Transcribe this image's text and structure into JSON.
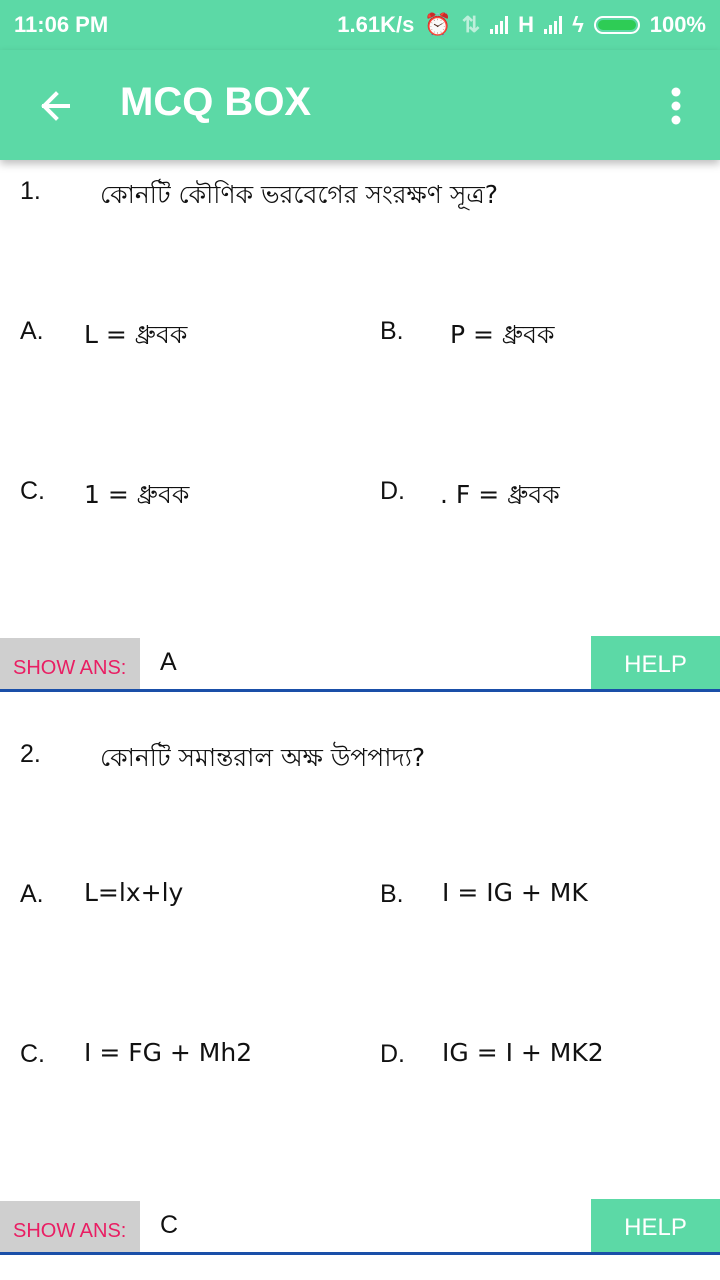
{
  "status_bar": {
    "time": "11:06 PM",
    "speed": "1.61K/s",
    "network": "H",
    "battery": "100%"
  },
  "app_bar": {
    "title": "MCQ BOX",
    "back_icon": "arrow-left-icon",
    "menu_icon": "more-vert-icon"
  },
  "colors": {
    "primary": "#5cd9a6",
    "show_ans_text": "#e91e63",
    "show_ans_bg": "#cfcfcf",
    "divider": "#1a4fa8"
  },
  "questions": [
    {
      "number": "1.",
      "text": "কোনটি কৌণিক ভরবেগের সংরক্ষণ সূত্র?",
      "options": [
        {
          "letter": "A.",
          "text": "L = ধ্রুবক"
        },
        {
          "letter": "B.",
          "text": "P = ধ্রুবক"
        },
        {
          "letter": "C.",
          "text": "1 = ধ্রুবক"
        },
        {
          "letter": "D.",
          "text": ". F = ধ্রুবক"
        }
      ],
      "show_ans_label": "SHOW ANS:",
      "answer": "A",
      "help_label": "HELP"
    },
    {
      "number": "2.",
      "text": "কোনটি সমান্তরাল অক্ষ উপপাদ্য?",
      "options": [
        {
          "letter": "A.",
          "text": "L=lx+ly"
        },
        {
          "letter": "B.",
          "text": "I = IG + MK"
        },
        {
          "letter": "C.",
          "text": "I = FG + Mh2"
        },
        {
          "letter": "D.",
          "text": "IG = I + MK2"
        }
      ],
      "show_ans_label": "SHOW ANS:",
      "answer": "C",
      "help_label": "HELP"
    }
  ]
}
